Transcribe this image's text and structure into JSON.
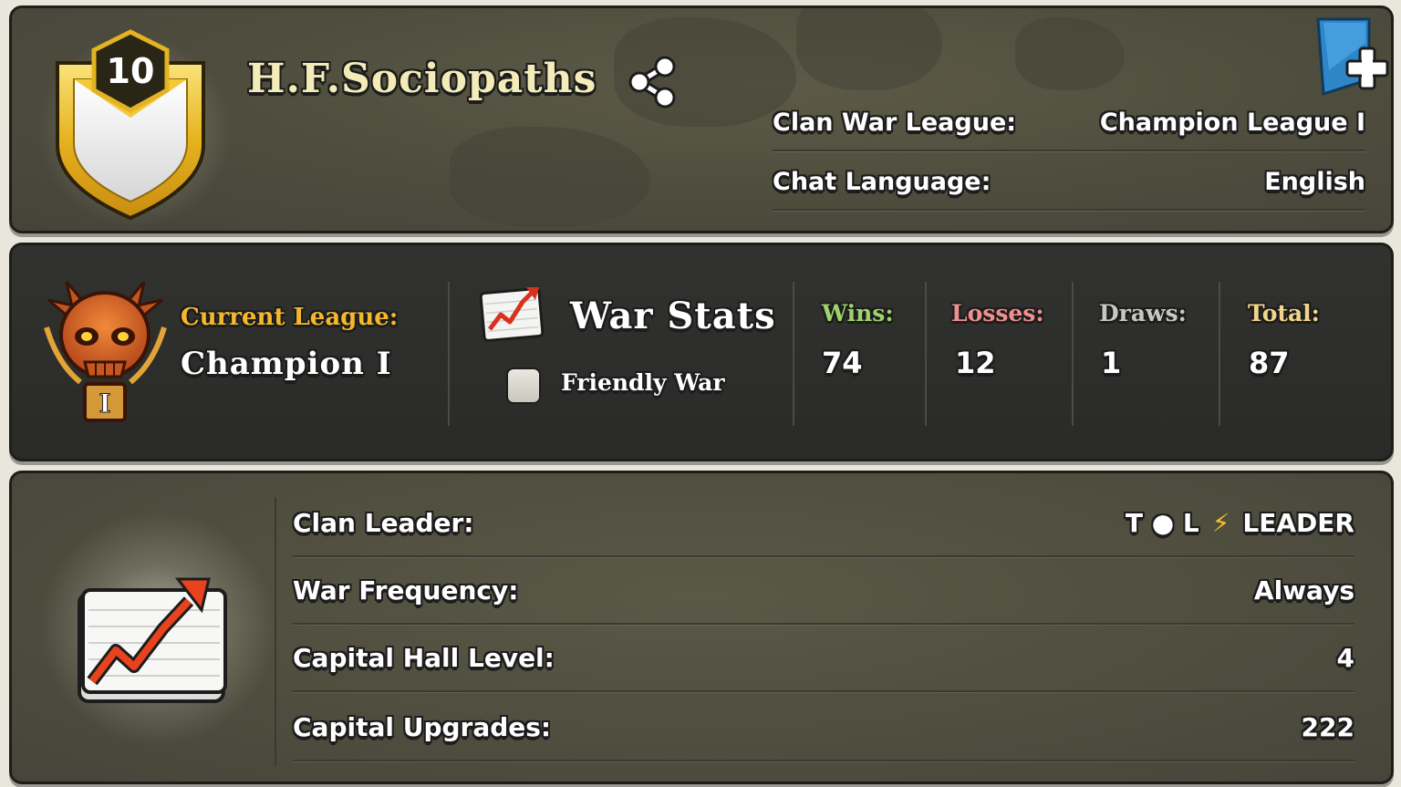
{
  "clan": {
    "level": "10",
    "name": "H.F.Sociopaths",
    "info": [
      {
        "label": "Clan War League:",
        "value": "Champion League I"
      },
      {
        "label": "Chat Language:",
        "value": "English"
      }
    ]
  },
  "league": {
    "label": "Current League:",
    "value": "Champion I",
    "badge_numeral": "I"
  },
  "war_stats": {
    "title": "War Stats",
    "friendly_war_label": "Friendly War",
    "friendly_war_checked": false,
    "wins_label": "Wins:",
    "wins": "74",
    "losses_label": "Losses:",
    "losses": "12",
    "draws_label": "Draws:",
    "draws": "1",
    "total_label": "Total:",
    "total": "87"
  },
  "details": {
    "leader_label": "Clan Leader:",
    "leader_name": "T ● L",
    "leader_separator": "⚡",
    "leader_role": "LEADER",
    "frequency_label": "War Frequency:",
    "frequency_value": "Always",
    "capital_hall_label": "Capital Hall Level:",
    "capital_hall_value": "4",
    "capital_upgrades_label": "Capital Upgrades:",
    "capital_upgrades_value": "222"
  },
  "colors": {
    "wins": "#9ed36a",
    "losses": "#f08f8f",
    "draws": "#c9c8c0",
    "total": "#f1d58a",
    "league_label": "#f5b82c",
    "bookmark": "#2e86c8"
  },
  "icons": {
    "share": "share-icon",
    "bookmark": "bookmark-plus-icon",
    "war_stats": "chart-up-icon",
    "league": "champion-league-skull-icon"
  }
}
